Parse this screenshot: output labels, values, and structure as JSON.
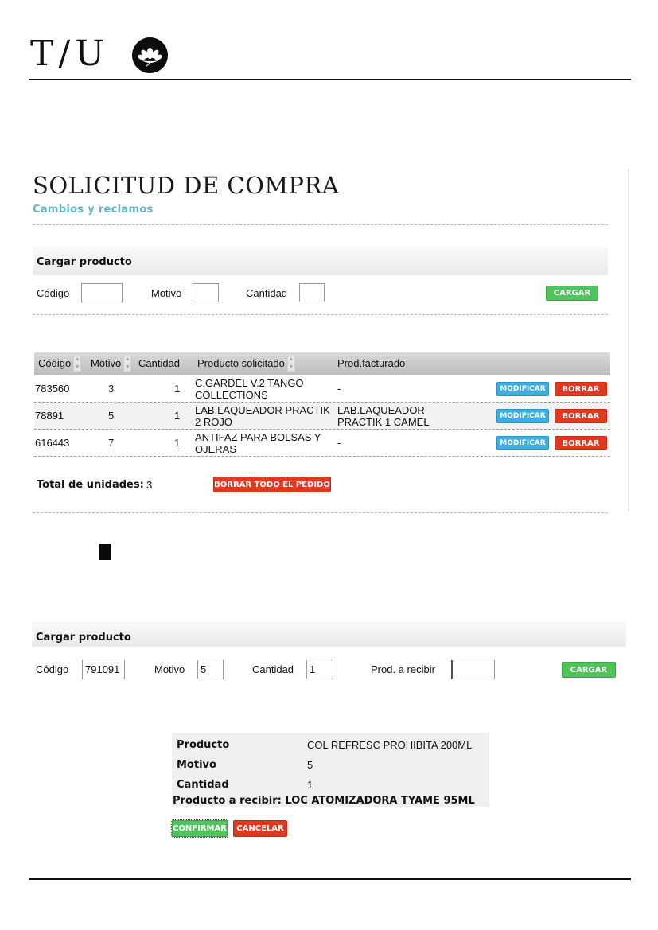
{
  "header": {
    "logo_text": "T/U",
    "logo_icon": "flower-emblem-icon"
  },
  "page": {
    "title": "SOLICITUD DE COMPRA",
    "subtitle": "Cambios y reclamos"
  },
  "load_panel": {
    "title": "Cargar producto",
    "codigo_label": "Código",
    "motivo_label": "Motivo",
    "cantidad_label": "Cantidad",
    "codigo_value": "",
    "motivo_value": "",
    "cantidad_value": "",
    "button": "CARGAR"
  },
  "table": {
    "headers": [
      "Código",
      "Motivo",
      "Cantidad",
      "Producto solicitado",
      "Prod.facturado"
    ],
    "rows": [
      {
        "codigo": "783560",
        "motivo": "3",
        "cantidad": "1",
        "producto": "C.GARDEL V.2 TANGO COLLECTIONS",
        "facturado": "-"
      },
      {
        "codigo": "78891",
        "motivo": "5",
        "cantidad": "1",
        "producto": "LAB.LAQUEADOR PRACTIK 2 ROJO",
        "facturado": "LAB.LAQUEADOR PRACTIK 1 CAMEL"
      },
      {
        "codigo": "616443",
        "motivo": "7",
        "cantidad": "1",
        "producto": "ANTIFAZ PARA BOLSAS Y OJERAS",
        "facturado": "-"
      }
    ],
    "modify_label": "MODIFICAR",
    "delete_label": "BORRAR"
  },
  "totals": {
    "label": "Total de unidades:",
    "value": "3",
    "delete_all": "BORRAR TODO EL PEDIDO"
  },
  "load_panel_2": {
    "title": "Cargar producto",
    "codigo_label": "Código",
    "motivo_label": "Motivo",
    "cantidad_label": "Cantidad",
    "recibir_label": "Prod. a recibir",
    "codigo_value": "791091",
    "motivo_value": "5",
    "cantidad_value": "1",
    "recibir_value": "",
    "button": "CARGAR"
  },
  "summary": {
    "producto_label": "Producto",
    "producto_value": "COL REFRESC PROHIBITA 200ML",
    "motivo_label": "Motivo",
    "motivo_value": "5",
    "cantidad_label": "Cantidad",
    "cantidad_value": "1",
    "recibir_line": "Producto a recibir: LOC ATOMIZADORA TYAME 95ML"
  },
  "actions": {
    "confirm": "CONFIRMAR",
    "cancel": "CANCELAR"
  },
  "colors": {
    "accent": "#5cb8c7",
    "green": "#4fc45a",
    "red": "#e0391f",
    "blue": "#3eaee0"
  }
}
